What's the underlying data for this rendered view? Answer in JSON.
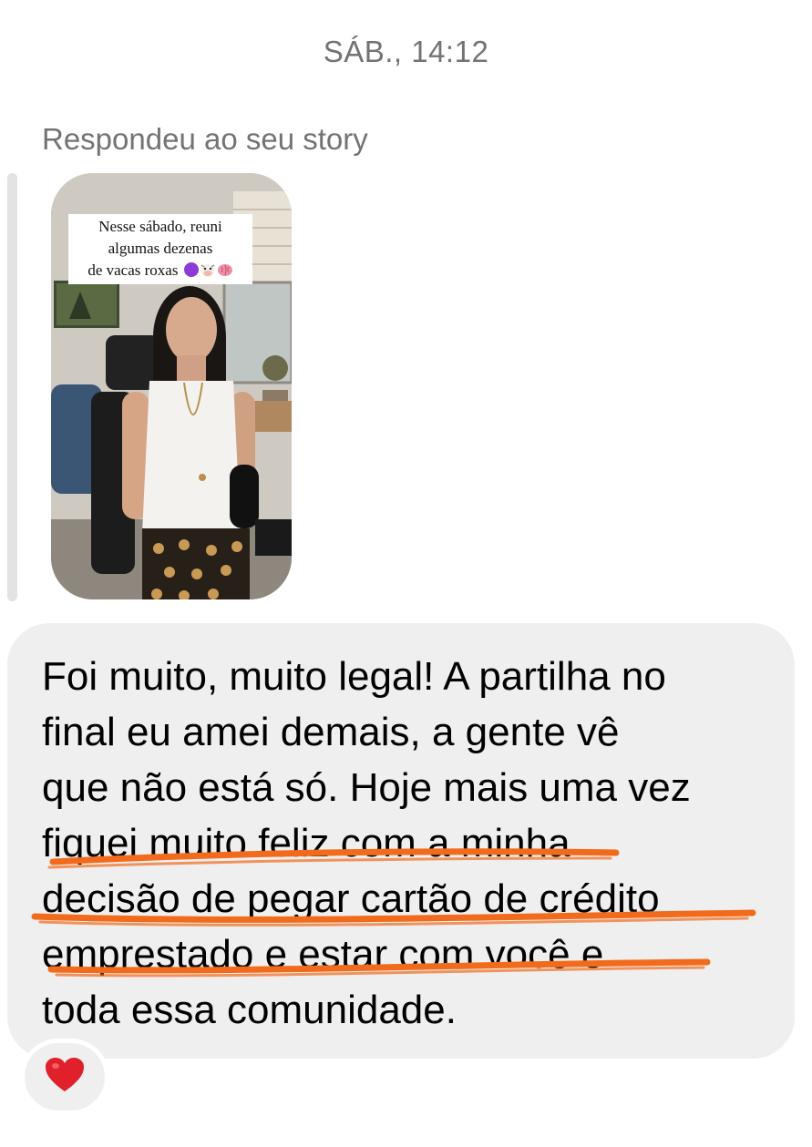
{
  "thread": {
    "timestamp": "SÁB., 14:12"
  },
  "story_reply": {
    "label": "Respondeu ao seu story",
    "caption_line1": "Nesse sábado, reuni",
    "caption_line2": "algumas dezenas",
    "caption_line3": "de vacas roxas",
    "caption_emojis": [
      "purple-circle-icon",
      "cow-face-icon",
      "brain-icon"
    ]
  },
  "message": {
    "text": "Foi muito, muito legal! A partilha no\nfinal eu amei demais, a gente vê\nque não está só. Hoje mais uma vez\nfiquei muito feliz com a minha\ndecisão de pegar cartão de crédito\nemprestado e estar com você e\ntoda essa comunidade.",
    "highlight_color": "#f26b1d"
  },
  "reaction": {
    "emoji": "red-heart-icon",
    "color": "#e0202b"
  }
}
